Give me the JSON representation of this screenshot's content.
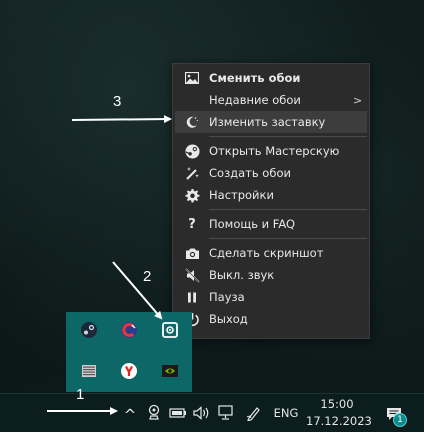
{
  "menu": {
    "items": [
      {
        "label": "Сменить обои",
        "icon": "image-icon"
      },
      {
        "label": "Недавние обои",
        "icon": "",
        "submenu_arrow": ">"
      },
      {
        "label": "Изменить заставку",
        "icon": "moon-icon"
      },
      {
        "label": "Открыть Мастерскую",
        "icon": "steam-icon"
      },
      {
        "label": "Создать обои",
        "icon": "magic-wand-icon"
      },
      {
        "label": "Настройки",
        "icon": "gear-icon"
      },
      {
        "label": "Помощь и FAQ",
        "icon": "question-icon"
      },
      {
        "label": "Сделать скриншот",
        "icon": "camera-icon"
      },
      {
        "label": "Выкл. звук",
        "icon": "mute-icon"
      },
      {
        "label": "Пауза",
        "icon": "pause-icon"
      },
      {
        "label": "Выход",
        "icon": "power-icon"
      }
    ]
  },
  "tray_overflow": {
    "icons": [
      "steam-icon",
      "ccleaner-icon",
      "wallpaper-engine-icon",
      "keyboard-icon",
      "yandex-browser-icon",
      "nvidia-icon"
    ]
  },
  "taskbar": {
    "chevron": "^",
    "language": "ENG",
    "time": "15:00",
    "date": "17.12.2023",
    "notification_count": "1"
  },
  "annotations": {
    "a1": "1",
    "a2": "2",
    "a3": "3"
  },
  "colors": {
    "menu_bg": "#2b2b2b",
    "highlight": "#3d3d3d",
    "tray_bg": "#0d6767",
    "taskbar_bg": "#0b1d1d"
  }
}
